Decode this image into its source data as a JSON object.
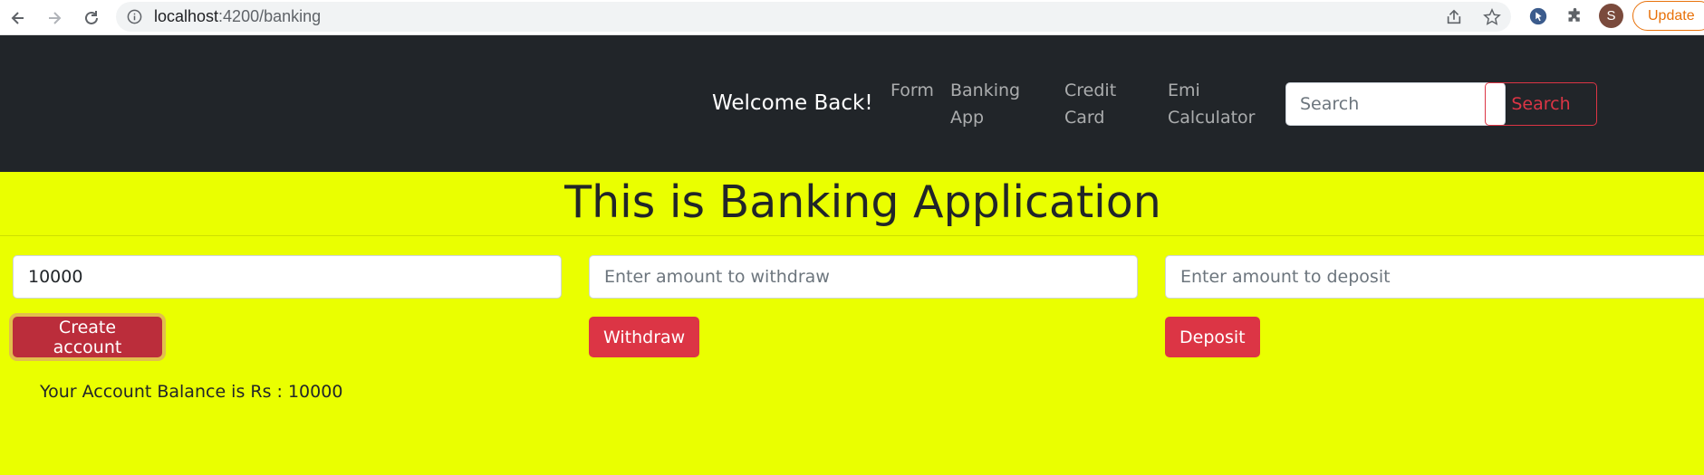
{
  "browser": {
    "url_host": "localhost",
    "url_path": ":4200/banking",
    "avatar_letter": "S",
    "update_label": "Update"
  },
  "navbar": {
    "brand": "Welcome Back!",
    "links": [
      {
        "line1": "Form",
        "line2": ""
      },
      {
        "line1": "Banking",
        "line2": "App"
      },
      {
        "line1": "Credit",
        "line2": "Card"
      },
      {
        "line1": "Emi",
        "line2": "Calculator"
      }
    ],
    "search_placeholder": "Search",
    "search_button": "Search"
  },
  "main": {
    "title": "This is Banking Application",
    "create_value": "10000",
    "withdraw_placeholder": "Enter amount to withdraw",
    "deposit_placeholder": "Enter amount to deposit",
    "create_button": "Create account",
    "withdraw_button": "Withdraw",
    "deposit_button": "Deposit",
    "balance_text": "Your Account Balance is Rs : 10000"
  },
  "colors": {
    "navbar_bg": "#212529",
    "main_bg": "#eaff00",
    "danger": "#dc3545",
    "update_accent": "#e8710a"
  },
  "icons": [
    "back-arrow-icon",
    "forward-arrow-icon",
    "reload-icon",
    "info-icon",
    "share-icon",
    "star-icon",
    "extension-icon",
    "puzzle-icon"
  ]
}
